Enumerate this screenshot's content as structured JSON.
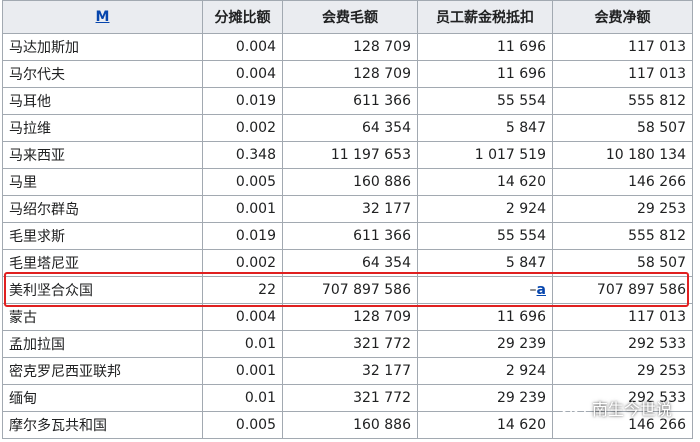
{
  "table": {
    "headers": [
      "M",
      "分摊比额",
      "会费毛额",
      "员工薪金税抵扣",
      "会费净额"
    ],
    "rows": [
      [
        "马达加斯加",
        "0.004",
        "128 709",
        "11 696",
        "117 013"
      ],
      [
        "马尔代夫",
        "0.004",
        "128 709",
        "11 696",
        "117 013"
      ],
      [
        "马耳他",
        "0.019",
        "611 366",
        "55 554",
        "555 812"
      ],
      [
        "马拉维",
        "0.002",
        "64 354",
        "5 847",
        "58 507"
      ],
      [
        "马来西亚",
        "0.348",
        "11 197 653",
        "1 017 519",
        "10 180 134"
      ],
      [
        "马里",
        "0.005",
        "160 886",
        "14 620",
        "146 266"
      ],
      [
        "马绍尔群岛",
        "0.001",
        "32 177",
        "2 924",
        "29 253"
      ],
      [
        "毛里求斯",
        "0.019",
        "611 366",
        "55 554",
        "555 812"
      ],
      [
        "毛里塔尼亚",
        "0.002",
        "64 354",
        "5 847",
        "58 507"
      ],
      [
        "美利坚合众国",
        "22",
        "707 897 586",
        "–a",
        "707 897 586"
      ],
      [
        "蒙古",
        "0.004",
        "128 709",
        "11 696",
        "117 013"
      ],
      [
        "孟加拉国",
        "0.01",
        "321 772",
        "29 239",
        "292 533"
      ],
      [
        "密克罗尼西亚联邦",
        "0.001",
        "32 177",
        "2 924",
        "29 253"
      ],
      [
        "缅甸",
        "0.01",
        "321 772",
        "29 239",
        "292 533"
      ],
      [
        "摩尔多瓦共和国",
        "0.005",
        "160 886",
        "14 620",
        "146 266"
      ]
    ],
    "us_row": {
      "dash": "–",
      "note": "a"
    }
  },
  "watermark": {
    "icon": "wechat-icon",
    "text": "南生今世说"
  }
}
